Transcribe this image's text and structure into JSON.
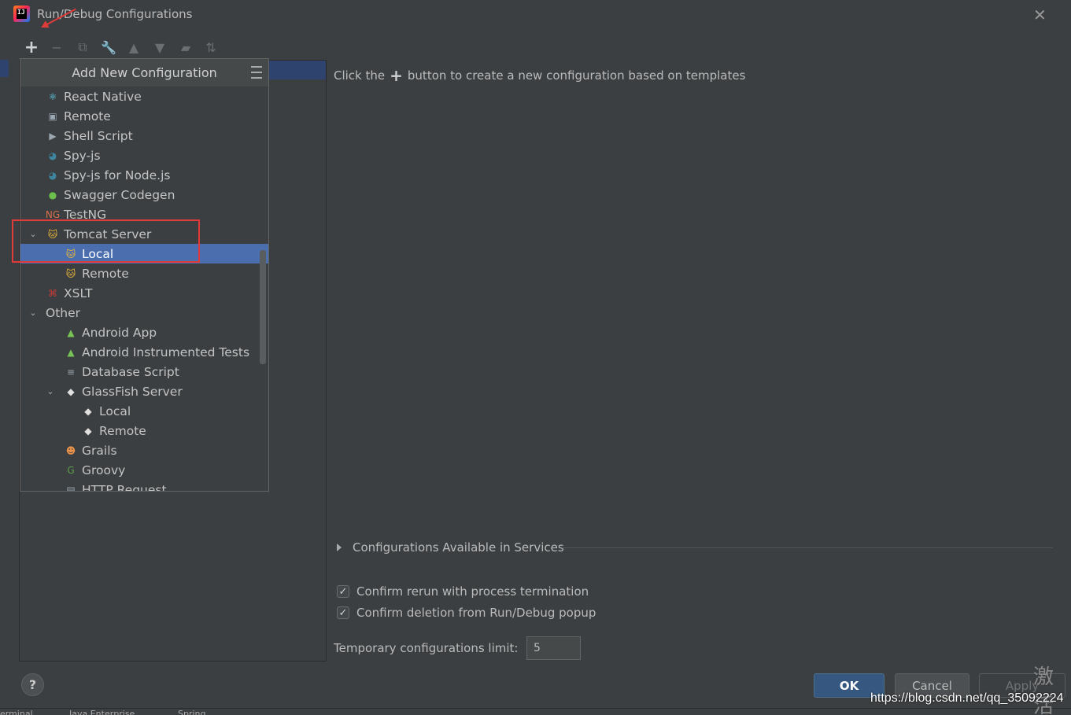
{
  "window": {
    "title": "Run/Debug Configurations",
    "logo_text": "IJ",
    "close_glyph": "✕"
  },
  "toolbar": {
    "buttons": [
      {
        "name": "add-icon",
        "glyph": "+"
      },
      {
        "name": "remove-icon",
        "glyph": "−"
      },
      {
        "name": "copy-icon",
        "glyph": "⧉"
      },
      {
        "name": "wrench-icon",
        "glyph": "🔧"
      },
      {
        "name": "move-up-icon",
        "glyph": "▲"
      },
      {
        "name": "move-down-icon",
        "glyph": "▼"
      },
      {
        "name": "folder-icon",
        "glyph": "▰"
      },
      {
        "name": "sort-icon",
        "glyph": "⇅"
      }
    ]
  },
  "popup": {
    "title": "Add New Configuration",
    "items": [
      {
        "label": "React Native",
        "icon": "react-icon",
        "glyph": "⚛",
        "color": "#61dafb",
        "level": 0,
        "chevron": ""
      },
      {
        "label": "Remote",
        "icon": "remote-icon",
        "glyph": "▣",
        "color": "#9aa7b0",
        "level": 0,
        "chevron": ""
      },
      {
        "label": "Shell Script",
        "icon": "shell-script-icon",
        "glyph": "▶",
        "color": "#9aa7b0",
        "level": 0,
        "chevron": ""
      },
      {
        "label": "Spy-js",
        "icon": "spy-js-icon",
        "glyph": "◕",
        "color": "#3e86a0",
        "level": 0,
        "chevron": ""
      },
      {
        "label": "Spy-js for Node.js",
        "icon": "spy-js-node-icon",
        "glyph": "◕",
        "color": "#3e86a0",
        "level": 0,
        "chevron": ""
      },
      {
        "label": "Swagger Codegen",
        "icon": "swagger-icon",
        "glyph": "●",
        "color": "#6bc04b",
        "level": 0,
        "chevron": ""
      },
      {
        "label": "TestNG",
        "icon": "testng-icon",
        "glyph": "NG",
        "color": "#d9704b",
        "level": 0,
        "chevron": ""
      },
      {
        "label": "Tomcat Server",
        "icon": "tomcat-icon",
        "glyph": "🐱",
        "color": "#e8b53c",
        "level": 0,
        "chevron": "⌄"
      },
      {
        "label": "Local",
        "icon": "tomcat-local-icon",
        "glyph": "🐱",
        "color": "#e8b53c",
        "level": 1,
        "chevron": "",
        "selected": true
      },
      {
        "label": "Remote",
        "icon": "tomcat-remote-icon",
        "glyph": "🐱",
        "color": "#e8b53c",
        "level": 1,
        "chevron": ""
      },
      {
        "label": "XSLT",
        "icon": "xslt-icon",
        "glyph": "⌘",
        "color": "#c73b3b",
        "level": 0,
        "chevron": ""
      },
      {
        "label": "Other",
        "icon": "",
        "glyph": "",
        "color": "",
        "level": -1,
        "chevron": "⌄"
      },
      {
        "label": "Android App",
        "icon": "android-icon",
        "glyph": "▲",
        "color": "#78c257",
        "level": 1,
        "chevron": ""
      },
      {
        "label": "Android Instrumented Tests",
        "icon": "android-tests-icon",
        "glyph": "▲",
        "color": "#78c257",
        "level": 1,
        "chevron": ""
      },
      {
        "label": "Database Script",
        "icon": "database-script-icon",
        "glyph": "≡",
        "color": "#9aa7b0",
        "level": 1,
        "chevron": ""
      },
      {
        "label": "GlassFish Server",
        "icon": "glassfish-icon",
        "glyph": "◆",
        "color": "#e0e0e0",
        "level": 1,
        "chevron": "⌄"
      },
      {
        "label": "Local",
        "icon": "glassfish-local-icon",
        "glyph": "◆",
        "color": "#e0e0e0",
        "level": 2,
        "chevron": ""
      },
      {
        "label": "Remote",
        "icon": "glassfish-remote-icon",
        "glyph": "◆",
        "color": "#e0e0e0",
        "level": 2,
        "chevron": ""
      },
      {
        "label": "Grails",
        "icon": "grails-icon",
        "glyph": "☻",
        "color": "#e8914b",
        "level": 1,
        "chevron": ""
      },
      {
        "label": "Groovy",
        "icon": "groovy-icon",
        "glyph": "G",
        "color": "#5a9e4b",
        "level": 1,
        "chevron": ""
      },
      {
        "label": "HTTP Request",
        "icon": "http-request-icon",
        "glyph": "▤",
        "color": "#9aa7b0",
        "level": 1,
        "chevron": ""
      }
    ]
  },
  "right": {
    "hint_before": "Click the",
    "hint_plus": "+",
    "hint_after": "button to create a new configuration based on templates",
    "services_label": "Configurations Available in Services",
    "confirm_rerun": "Confirm rerun with process termination",
    "confirm_rerun_checked": true,
    "confirm_delete": "Confirm deletion from Run/Debug popup",
    "confirm_delete_checked": true,
    "limit_label": "Temporary configurations limit:",
    "limit_value": "5"
  },
  "buttons": {
    "help": "?",
    "ok": "OK",
    "cancel": "Cancel",
    "apply": "Apply"
  },
  "taskbar": {
    "items": [
      "erminal",
      "Java Enterprise",
      "Spring"
    ]
  },
  "overlay": {
    "watermark": "https://blog.csdn.net/qq_35092224",
    "corner_text": "激活"
  }
}
